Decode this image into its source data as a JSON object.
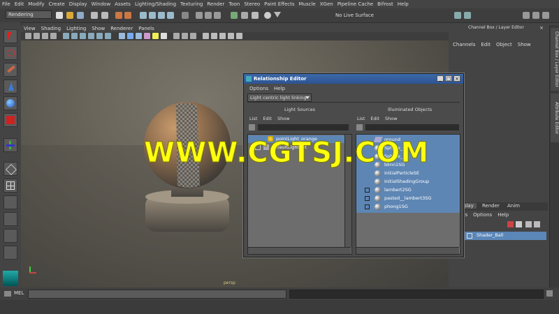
{
  "menubar": [
    "File",
    "Edit",
    "Modify",
    "Create",
    "Display",
    "Window",
    "Assets",
    "Lighting/Shading",
    "Texturing",
    "Render",
    "Toon",
    "Stereo",
    "Paint Effects",
    "Muscle",
    "XGen",
    "Pipeline Cache",
    "Bifrost",
    "Help"
  ],
  "shelf": {
    "mode": "Rendering",
    "live_surface": "No Live Surface"
  },
  "viewport": {
    "menu": [
      "View",
      "Shading",
      "Lighting",
      "Show",
      "Renderer",
      "Panels"
    ],
    "camera": "persp"
  },
  "right_panel": {
    "header": "Channel Box / Layer Editor",
    "menu": [
      "Channels",
      "Edit",
      "Object",
      "Show"
    ],
    "layer_tabs": [
      "Display",
      "Render",
      "Anim"
    ],
    "layer_menu": [
      "Layers",
      "Options",
      "Help"
    ],
    "layer_row": "Shader_Ball",
    "vertical_tabs": [
      "Channel Box / Layer Editor",
      "Attribute Editor"
    ]
  },
  "relationship_editor": {
    "title": "Relationship Editor",
    "menu": [
      "Options",
      "Help"
    ],
    "mode": "Light centric light linking",
    "left": {
      "header": "Light Sources",
      "menu": [
        "List",
        "Edit",
        "Show"
      ],
      "items": [
        "pointLight_orange",
        "defaultLightSet"
      ]
    },
    "right": {
      "header": "Illuminated Objects",
      "menu": [
        "List",
        "Edit",
        "Show"
      ],
      "items": [
        "ground",
        "Sphere_R",
        "Sphere_L",
        "blinn1SG",
        "initialParticleSE",
        "initialShadingGroup",
        "lambert2SG",
        "pasted__lambert3SG",
        "phong1SG"
      ]
    }
  },
  "commandline": {
    "label": "MEL"
  },
  "watermark": "WWW.CGTSJ.COM"
}
